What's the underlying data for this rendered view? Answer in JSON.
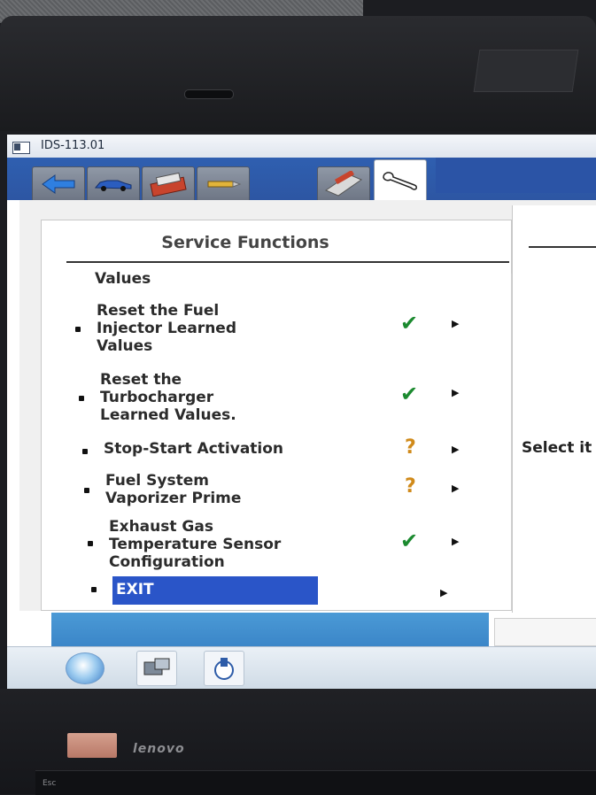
{
  "window": {
    "title": "IDS-113.01",
    "active_tab": "toolbox-tab"
  },
  "panel": {
    "title": "Service Functions",
    "items": [
      {
        "label": "Values",
        "status": "none",
        "bullet": false
      },
      {
        "label": "Reset the Fuel\nInjector Learned\nValues",
        "status": "check",
        "bullet": true
      },
      {
        "label": "Reset the\nTurbocharger\nLearned Values.",
        "status": "check",
        "bullet": true
      },
      {
        "label": "Stop-Start Activation",
        "status": "question",
        "bullet": true
      },
      {
        "label": "Fuel System\nVaporizer Prime",
        "status": "question",
        "bullet": true
      },
      {
        "label": "Exhaust Gas\nTemperature Sensor\nConfiguration",
        "status": "check",
        "bullet": true
      },
      {
        "label": "EXIT",
        "status": "none",
        "bullet": true,
        "selected": true
      }
    ]
  },
  "right_panel": {
    "text": "Select it"
  },
  "device": {
    "brand": "lenovo",
    "esc_key": "Esc"
  },
  "colors": {
    "toolbar_blue": "#2f5fb0",
    "selection_blue": "#2a55c8",
    "check_green": "#1b8a2f",
    "question_orange": "#d08a1a"
  }
}
